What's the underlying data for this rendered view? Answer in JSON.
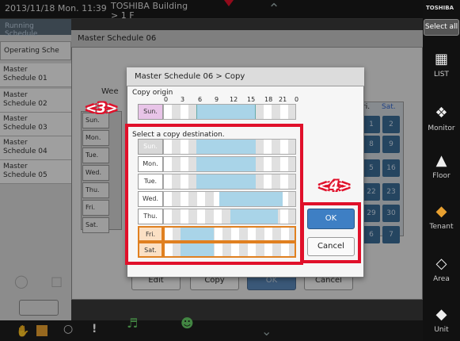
{
  "topbar": {
    "datetime": "2013/11/18  Mon.  11:39",
    "building_line1": "TOSHIBA Building",
    "building_line2": "> 1 F"
  },
  "sidebar": {
    "brand": "TOSHIBA",
    "select_all": "Select all",
    "items": [
      {
        "label": "LIST",
        "icon": "list-icon"
      },
      {
        "label": "Monitor",
        "icon": "monitor-icon"
      },
      {
        "label": "Floor",
        "icon": "floor-icon"
      },
      {
        "label": "Tenant",
        "icon": "tenant-icon"
      },
      {
        "label": "Area",
        "icon": "area-icon"
      },
      {
        "label": "Unit",
        "icon": "unit-icon"
      }
    ]
  },
  "left": {
    "running_schedule": "Running Schedule",
    "operating_schedule": "Operating Sche",
    "schedules": [
      {
        "l1": "Master",
        "l2": "Schedule 01"
      },
      {
        "l1": "Master",
        "l2": "Schedule 02"
      },
      {
        "l1": "Master",
        "l2": "Schedule 03"
      },
      {
        "l1": "Master",
        "l2": "Schedule 04"
      },
      {
        "l1": "Master",
        "l2": "Schedule 05"
      }
    ]
  },
  "master_panel": {
    "title": "Master Schedule 06",
    "week_label": "Wee",
    "bg_days": [
      "Sun.",
      "Mon.",
      "Tue.",
      "Wed.",
      "Thu.",
      "Fri.",
      "Sat."
    ],
    "cal_header": [
      "ri.",
      "Sat."
    ],
    "cal_numbers": [
      [
        "1",
        "2"
      ],
      [
        "8",
        "9"
      ],
      [
        "5",
        "16"
      ],
      [
        "22",
        "23"
      ],
      [
        "29",
        "30"
      ],
      [
        "6",
        "7"
      ]
    ],
    "buttons": {
      "edit": "Edit",
      "copy": "Copy",
      "ok": "OK",
      "cancel": "Cancel"
    }
  },
  "dialog": {
    "title": "Master Schedule 06 > Copy",
    "copy_origin_label": "Copy origin",
    "ticks": [
      "0",
      "3",
      "6",
      "9",
      "12",
      "15",
      "18",
      "21",
      "0"
    ],
    "origin_day": "Sun.",
    "select_destination": "Select a copy destination.",
    "days": [
      "Sun.",
      "Mon.",
      "Tue.",
      "Wed.",
      "Thu.",
      "Fri.",
      "Sat."
    ],
    "ok": "OK",
    "cancel": "Cancel"
  },
  "annotations": {
    "box3": "<3>",
    "box4": "<4>"
  },
  "colors": {
    "accent": "#3e7fc4",
    "annotation": "#e0102a",
    "schedule_fill": "#a9d4e8",
    "selected_day": "#fbe0c4",
    "origin_day": "#e8c4e8"
  }
}
